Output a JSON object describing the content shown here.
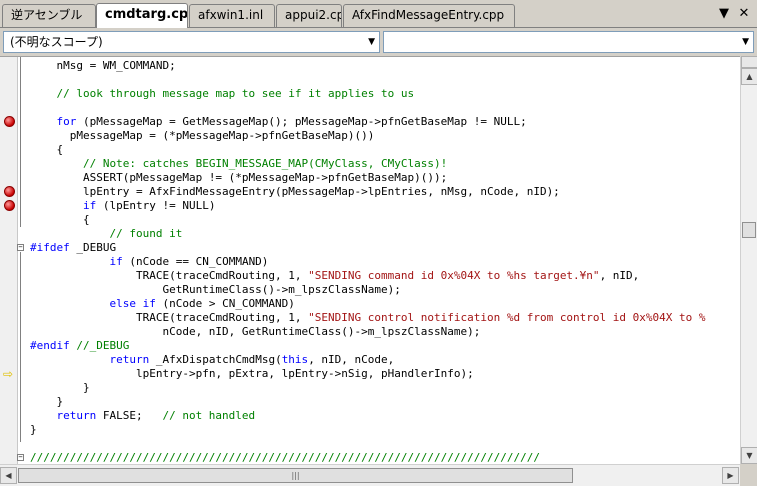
{
  "tabs": [
    {
      "label": "逆アセンブル",
      "active": false
    },
    {
      "label": "cmdtarg.cpp",
      "active": true
    },
    {
      "label": "afxwin1.inl",
      "active": false
    },
    {
      "label": "appui2.cpp",
      "active": false
    },
    {
      "label": "AfxFindMessageEntry.cpp",
      "active": false
    }
  ],
  "tab_controls": {
    "dropdown": "▼",
    "close": "✕"
  },
  "scope_combo": {
    "value": "(不明なスコープ)"
  },
  "member_combo": {
    "value": ""
  },
  "code_lines": [
    [
      {
        "t": "tx",
        "s": "\tnMsg = WM_COMMAND;"
      }
    ],
    [
      {
        "t": "tx",
        "s": ""
      }
    ],
    [
      {
        "t": "cm",
        "s": "\t// look through message map to see if it applies to us"
      }
    ],
    [
      {
        "t": "tx",
        "s": ""
      }
    ],
    [
      {
        "t": "kw",
        "s": "\tfor"
      },
      {
        "t": "tx",
        "s": " (pMessageMap = GetMessageMap(); pMessageMap->pfnGetBaseMap != NULL;"
      }
    ],
    [
      {
        "t": "tx",
        "s": "\t  pMessageMap = (*pMessageMap->pfnGetBaseMap)())"
      }
    ],
    [
      {
        "t": "tx",
        "s": "\t{"
      }
    ],
    [
      {
        "t": "cm",
        "s": "\t\t// Note: catches BEGIN_MESSAGE_MAP(CMyClass, CMyClass)!"
      }
    ],
    [
      {
        "t": "tx",
        "s": "\t\tASSERT(pMessageMap != (*pMessageMap->pfnGetBaseMap)());"
      }
    ],
    [
      {
        "t": "tx",
        "s": "\t\tlpEntry = AfxFindMessageEntry(pMessageMap->lpEntries, nMsg, nCode, nID);"
      }
    ],
    [
      {
        "t": "kw",
        "s": "\t\tif"
      },
      {
        "t": "tx",
        "s": " (lpEntry != NULL)"
      }
    ],
    [
      {
        "t": "tx",
        "s": "\t\t{"
      }
    ],
    [
      {
        "t": "cm",
        "s": "\t\t\t// found it"
      }
    ],
    [
      {
        "t": "kw",
        "s": "#ifdef"
      },
      {
        "t": "tx",
        "s": " _DEBUG"
      }
    ],
    [
      {
        "t": "kw",
        "s": "\t\t\tif"
      },
      {
        "t": "tx",
        "s": " (nCode == CN_COMMAND)"
      }
    ],
    [
      {
        "t": "tx",
        "s": "\t\t\t\tTRACE(traceCmdRouting, 1, "
      },
      {
        "t": "st",
        "s": "\"SENDING command id 0x%04X to %hs target.¥n\""
      },
      {
        "t": "tx",
        "s": ", nID,"
      }
    ],
    [
      {
        "t": "tx",
        "s": "\t\t\t\t\tGetRuntimeClass()->m_lpszClassName);"
      }
    ],
    [
      {
        "t": "kw",
        "s": "\t\t\telse if"
      },
      {
        "t": "tx",
        "s": " (nCode > CN_COMMAND)"
      }
    ],
    [
      {
        "t": "tx",
        "s": "\t\t\t\tTRACE(traceCmdRouting, 1, "
      },
      {
        "t": "st",
        "s": "\"SENDING control notification %d from control id 0x%04X to %"
      }
    ],
    [
      {
        "t": "tx",
        "s": "\t\t\t\t\tnCode, nID, GetRuntimeClass()->m_lpszClassName);"
      }
    ],
    [
      {
        "t": "kw",
        "s": "#endif"
      },
      {
        "t": "cm",
        "s": " //_DEBUG"
      }
    ],
    [
      {
        "t": "kw",
        "s": "\t\t\treturn"
      },
      {
        "t": "tx",
        "s": " _AfxDispatchCmdMsg("
      },
      {
        "t": "kw",
        "s": "this"
      },
      {
        "t": "tx",
        "s": ", nID, nCode,"
      }
    ],
    [
      {
        "t": "tx",
        "s": "\t\t\t\tlpEntry->pfn, pExtra, lpEntry->nSig, pHandlerInfo);"
      }
    ],
    [
      {
        "t": "tx",
        "s": "\t\t}"
      }
    ],
    [
      {
        "t": "tx",
        "s": "\t}"
      }
    ],
    [
      {
        "t": "kw",
        "s": "\treturn"
      },
      {
        "t": "tx",
        "s": " FALSE;\t"
      },
      {
        "t": "cm",
        "s": "// not handled"
      }
    ],
    [
      {
        "t": "tx",
        "s": "}"
      }
    ],
    [
      {
        "t": "tx",
        "s": ""
      }
    ],
    [
      {
        "t": "cm",
        "s": "/////////////////////////////////////////////////////////////////////////////"
      }
    ]
  ],
  "breakpoint_lines": [
    4,
    9,
    10
  ],
  "instruction_pointer_line": 22,
  "scrollbar_arrows": {
    "up": "▲",
    "down": "▼",
    "left": "◀",
    "right": "▶",
    "grip": "|||"
  },
  "colors": {
    "comment": "#008000",
    "keyword": "#0000ff",
    "string": "#a31515",
    "breakpoint": "#c80000",
    "instruction_pointer": "#e0c000"
  }
}
